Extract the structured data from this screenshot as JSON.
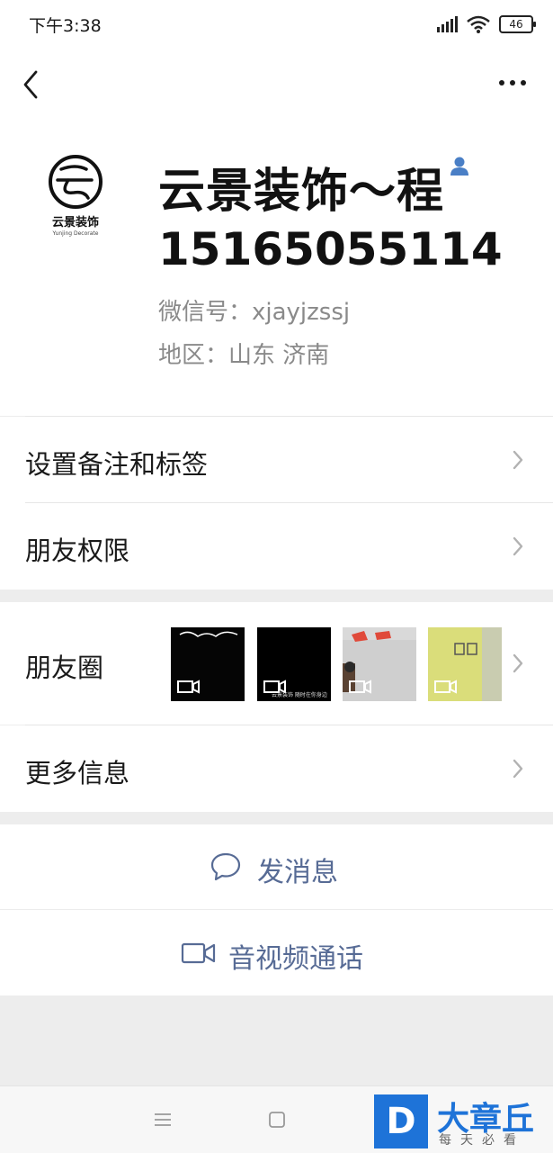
{
  "status_bar": {
    "time": "下午3:38",
    "network": "4G",
    "battery": "46"
  },
  "header": {
    "back_icon": "chevron-left-icon",
    "more_icon": "more-icon"
  },
  "profile": {
    "avatar_text": "云景装饰",
    "avatar_subtext": "Yunjing Decorate",
    "name": "云景装饰～程",
    "name_line2": "15165055114",
    "wechat_id": "微信号：xjayjzssj",
    "region": "地区：山东  济南"
  },
  "menu": {
    "remarks_tags": "设置备注和标签",
    "friend_permissions": "朋友权限",
    "moments": "朋友圈",
    "more_info": "更多信息"
  },
  "moments_thumbs": [
    {
      "type": "video",
      "bg": "#050505"
    },
    {
      "type": "video",
      "bg": "#000000",
      "caption": "云景装饰 随时在你身边"
    },
    {
      "type": "video",
      "bg": "#c8c8c8"
    },
    {
      "type": "video",
      "bg": "#d9dc78"
    }
  ],
  "actions": {
    "send_message": "发消息",
    "video_call": "音视频通话"
  },
  "watermark": {
    "logo_letter": "D",
    "title": "大章丘",
    "subtitle": "每天必看"
  },
  "colors": {
    "link": "#576b95",
    "text": "#1a1a1a",
    "muted": "#8a8a8a"
  }
}
